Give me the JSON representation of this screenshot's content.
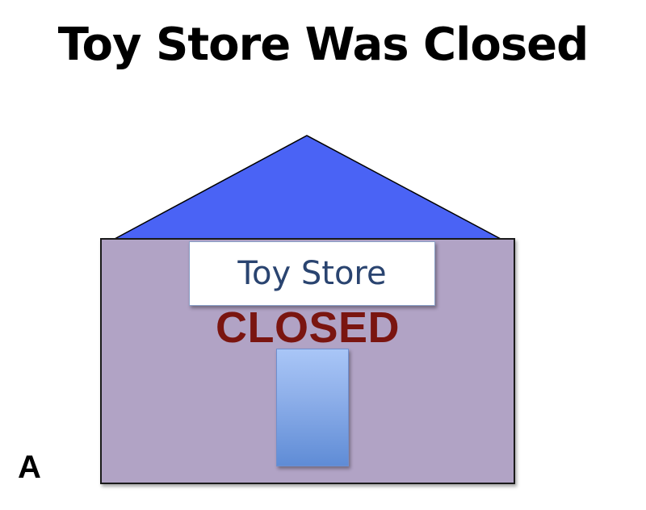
{
  "title": "Toy Store Was Closed",
  "store": {
    "sign_text": "Toy Store",
    "status_text": "CLOSED"
  },
  "panel_label": "A",
  "colors": {
    "roof": "#4a63f5",
    "wall": "#b1a3c5",
    "status_text": "#7a1510",
    "sign_text": "#2a4470",
    "door_top": "#a9c6f7",
    "door_bottom": "#5f8cd6"
  },
  "icons": {
    "roof": "triangle-roof",
    "door": "door-rectangle"
  }
}
